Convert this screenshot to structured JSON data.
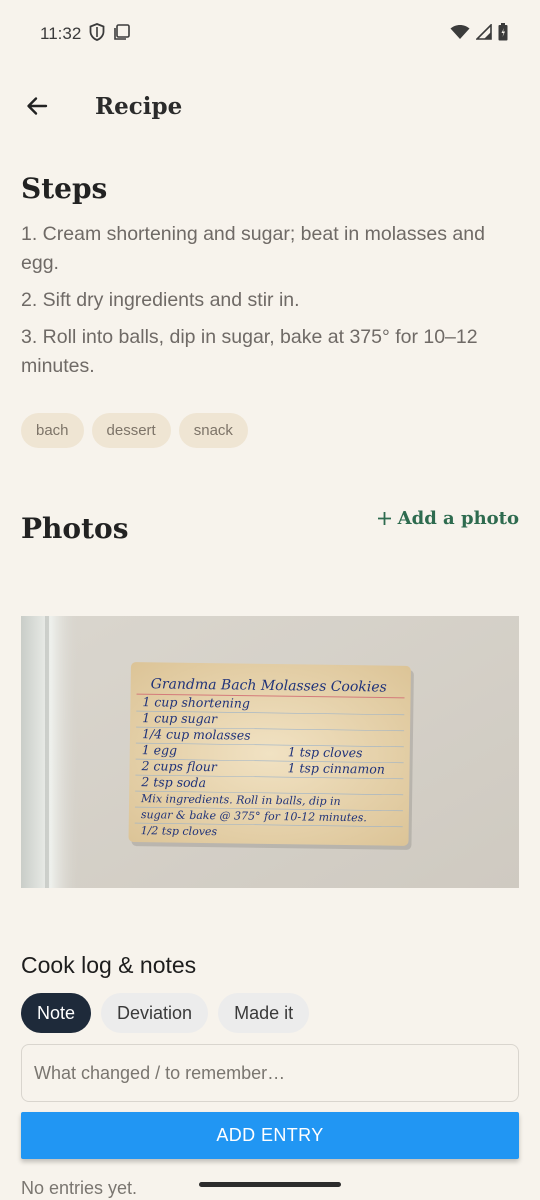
{
  "status_bar": {
    "time": "11:32"
  },
  "app_bar": {
    "title": "Recipe"
  },
  "steps": {
    "title": "Steps",
    "items": [
      "1. Cream shortening and sugar; beat in molasses and egg.",
      "2. Sift dry ingredients and stir in.",
      "3. Roll into balls, dip in sugar, bake at 375° for 10–12 minutes."
    ]
  },
  "tags": [
    "bach",
    "dessert",
    "snack"
  ],
  "photos": {
    "title": "Photos",
    "add_label": "Add a photo",
    "card": {
      "title": "Grandma Bach Molasses Cookies",
      "left_lines": [
        "1 cup shortening",
        "1 cup sugar",
        "1/4 cup molasses",
        "1 egg",
        "2 cups flour",
        "2 tsp soda"
      ],
      "right_lines": [
        "1 tsp cloves",
        "1 tsp cinnamon"
      ],
      "instructions": [
        "Mix ingredients. Roll in balls, dip in",
        "sugar & bake @ 375° for 10-12 minutes.",
        "1/2 tsp cloves"
      ]
    }
  },
  "cook_log": {
    "title": "Cook log & notes",
    "chips": [
      {
        "label": "Note",
        "active": true
      },
      {
        "label": "Deviation",
        "active": false
      },
      {
        "label": "Made it",
        "active": false
      }
    ],
    "input_placeholder": "What changed / to remember…",
    "add_button": "ADD ENTRY",
    "empty_text": "No entries yet."
  },
  "colors": {
    "background": "#f7f3ec",
    "accent_green": "#2e6b4f",
    "primary_button": "#2196f3",
    "chip_active": "#1e2a3a",
    "tag_bg": "#efe5d3"
  }
}
